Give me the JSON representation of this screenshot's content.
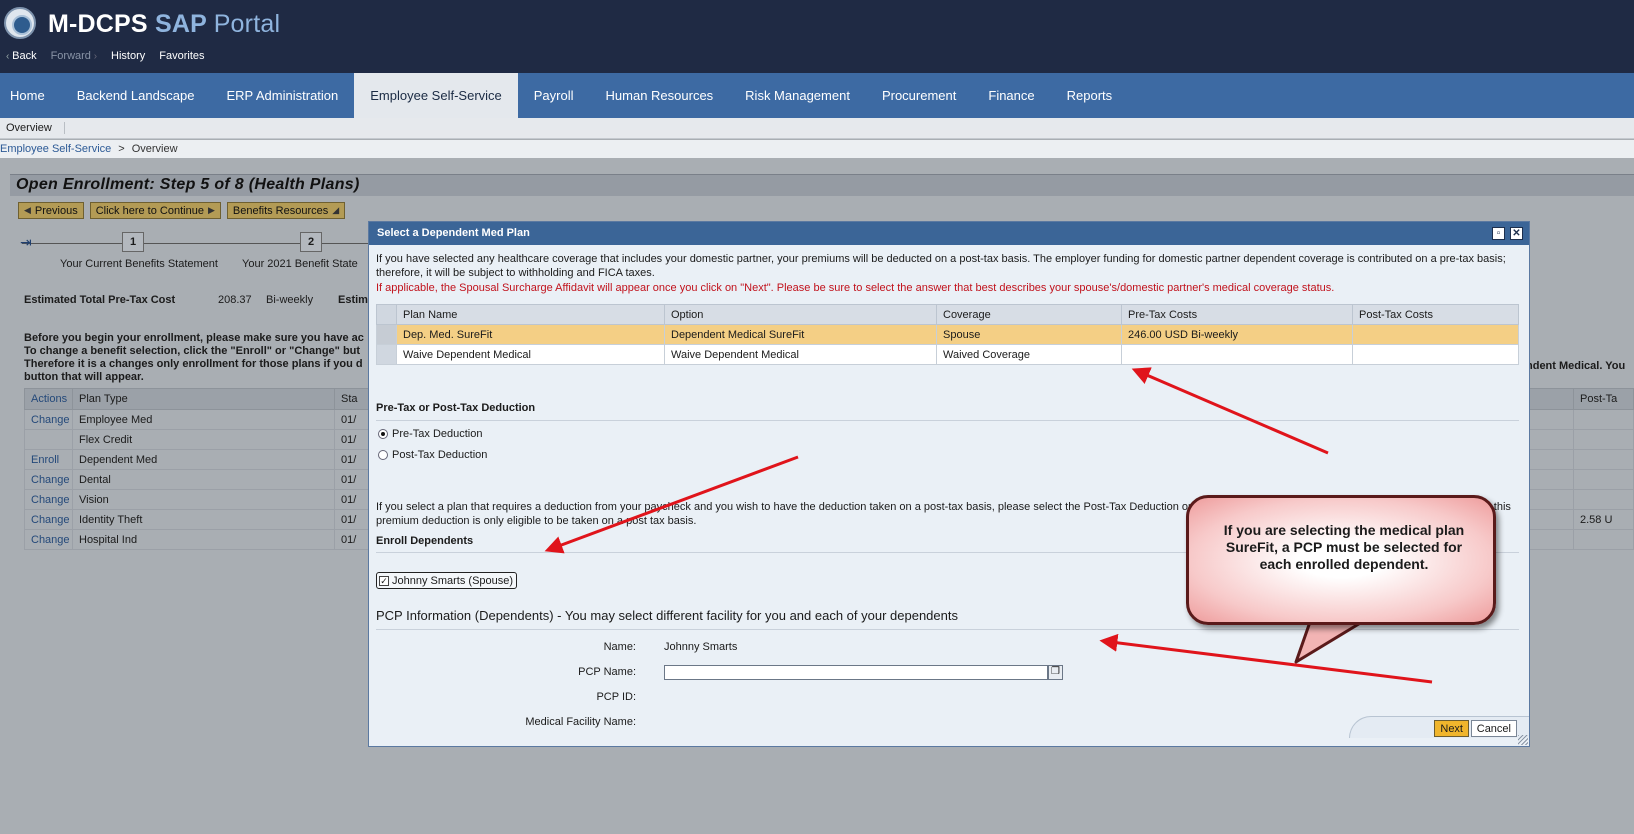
{
  "header": {
    "title_main": "M-DCPS",
    "title_sap": "SAP",
    "title_portal": "Portal",
    "history": [
      "Back",
      "Forward",
      "History",
      "Favorites"
    ]
  },
  "topnav": [
    "Home",
    "Backend Landscape",
    "ERP Administration",
    "Employee Self-Service",
    "Payroll",
    "Human Resources",
    "Risk Management",
    "Procurement",
    "Finance",
    "Reports"
  ],
  "subnav": {
    "overview": "Overview"
  },
  "breadcrumb": {
    "root": "Employee Self-Service",
    "sep": ">",
    "current": "Overview"
  },
  "page": {
    "step_title": "Open Enrollment: Step 5  of 8  (Health Plans)",
    "buttons": {
      "previous": "Previous",
      "continue": "Click here to Continue",
      "resources": "Benefits Resources"
    },
    "roadmap": [
      {
        "num": "1",
        "label": "Your Current Benefits Statement"
      },
      {
        "num": "2",
        "label": "Your 2021 Benefit State"
      }
    ],
    "cost_label": "Estimated Total Pre-Tax Cost",
    "cost_amount": "208.37",
    "cost_period": "Bi-weekly",
    "cost_est": "Estim",
    "intro_lines": [
      "Before you begin your enrollment, please make sure you have ac",
      "To change a benefit selection, click the \"Enroll\" or \"Change\" but",
      "Therefore it is a changes only enrollment for those plans if you d",
      "button that will appear."
    ],
    "intro_right": "ndent Medical. You",
    "table_headers": {
      "actions": "Actions",
      "plan_type": "Plan Type",
      "sta": "Sta",
      "post_tax": "Post-Ta"
    },
    "table_rows": [
      {
        "action": "Change",
        "plan": "Employee Med",
        "date": "01/",
        "post": ""
      },
      {
        "action": "",
        "plan": "Flex Credit",
        "date": "01/",
        "post": ""
      },
      {
        "action": "Enroll",
        "plan": "Dependent Med",
        "date": "01/",
        "post": ""
      },
      {
        "action": "Change",
        "plan": "Dental",
        "date": "01/",
        "post": ""
      },
      {
        "action": "Change",
        "plan": "Vision",
        "date": "01/",
        "post": ""
      },
      {
        "action": "Change",
        "plan": "Identity Theft",
        "date": "01/",
        "post": "2.58 U"
      },
      {
        "action": "Change",
        "plan": "Hospital Ind",
        "date": "01/",
        "post": ""
      }
    ]
  },
  "modal": {
    "title": "Select a Dependent Med Plan",
    "note1": "If you have selected any healthcare coverage that includes your domestic partner, your premiums will be deducted on a post-tax basis. The employer funding for domestic partner dependent coverage is contributed on a pre-tax basis; therefore, it will be subject to withholding and FICA taxes.",
    "note2": "If applicable, the Spousal Surcharge Affidavit will appear once you click on \"Next\". Please be sure to select the answer that best describes your spouse's/domestic partner's medical coverage status.",
    "columns": [
      "Plan Name",
      "Option",
      "Coverage",
      "Pre-Tax Costs",
      "Post-Tax Costs"
    ],
    "rows": [
      [
        "Dep. Med. SureFit",
        "Dependent Medical SureFit",
        "Spouse",
        "246.00 USD Bi-weekly",
        ""
      ],
      [
        "Waive Dependent  Medical",
        "Waive Dependent Medical",
        "Waived Coverage",
        "",
        ""
      ]
    ],
    "deduction_title": "Pre-Tax or Post-Tax Deduction",
    "radio_pre": "Pre-Tax Deduction",
    "radio_post": "Post-Tax Deduction",
    "deduct_note": "If you select a plan that requires a deduction from your paycheck and you wish to have the deduction taken on a post-tax basis, please select the Post-Tax Deduction option. If a Pre-Tax/Post-Tax Deduction option does not appear, this premium deduction is only eligible to be taken on a post tax basis.",
    "enroll_title": "Enroll Dependents",
    "dependent": "Johnny Smarts (Spouse)",
    "pcp_title": "PCP Information (Dependents) - You may select different facility for you and each of your dependents",
    "pcp_name_label": "Name:",
    "pcp_name_value": "Johnny Smarts",
    "pcp_pcpname_label": "PCP Name:",
    "pcp_id_label": "PCP ID:",
    "pcp_facility_label": "Medical Facility Name:",
    "next": "Next",
    "cancel": "Cancel"
  },
  "callout": {
    "text": "If you are selecting the medical plan SureFit, a PCP must be selected for each enrolled dependent."
  },
  "colors": {
    "header": "#1f2a44",
    "nav": "#3d6aa3",
    "modal_title": "#3b6597",
    "selected_row": "#f4cf85",
    "arrow": "#e0141b"
  }
}
